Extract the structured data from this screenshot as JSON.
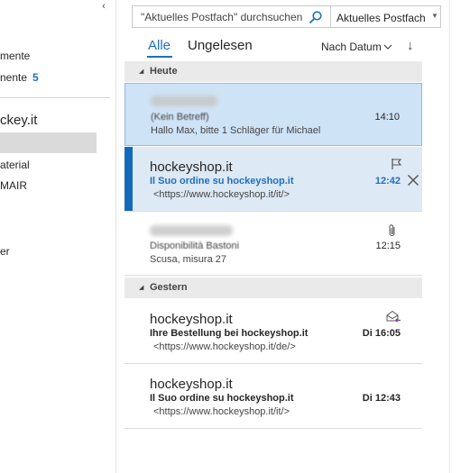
{
  "left_pane": {
    "collapse_glyph": "‹",
    "folders": [
      {
        "label": "mente"
      },
      {
        "label": "nente",
        "count": "5"
      }
    ],
    "account": "ckey.it",
    "subfolders": [
      {
        "label": ""
      },
      {
        "label": "aterial"
      },
      {
        "label": "MAIR"
      },
      {
        "label": "er"
      }
    ]
  },
  "search": {
    "placeholder": "\"Aktuelles Postfach\" durchsuchen",
    "icon": "search-icon",
    "scope": "Aktuelles Postfach"
  },
  "tabs": {
    "all": "Alle",
    "unread": "Ungelesen"
  },
  "sort": {
    "label": "Nach Datum",
    "direction_glyph": "↓"
  },
  "groups": [
    {
      "label": "Heute"
    },
    {
      "label": "Gestern"
    }
  ],
  "mails": [
    {
      "subject": "(Kein Betreff)",
      "preview": "Hallo Max, bitte 1 Schläger für Michael",
      "time": "14:10",
      "state": "selected"
    },
    {
      "sender": "hockeyshop.it",
      "subject": "Il Suo ordine su hockeyshop.it",
      "preview": "<https://www.hockeyshop.it/it/>",
      "time": "12:42",
      "state": "active",
      "icons": [
        "flag-icon",
        "delete-icon"
      ]
    },
    {
      "subject": "Disponibilità Bastoni",
      "preview": "Scusa, misura 27",
      "time": "12:15",
      "icons": [
        "paperclip-icon"
      ]
    },
    {
      "sender": "hockeyshop.it",
      "subject": "Ihre Bestellung bei hockeyshop.it",
      "preview": "<https://www.hockeyshop.it/de/>",
      "time": "Di 16:05",
      "icons": [
        "reply-envelope-icon"
      ]
    },
    {
      "sender": "hockeyshop.it",
      "subject": "Il Suo ordine su hockeyshop.it",
      "preview": "<https://www.hockeyshop.it/it/>",
      "time": "Di 12:43"
    }
  ],
  "colors": {
    "accent": "#1e6fbd",
    "selected_bg": "#cfe3f6",
    "active_bar": "#1469b8",
    "group_header_bg": "#eaeaea"
  }
}
